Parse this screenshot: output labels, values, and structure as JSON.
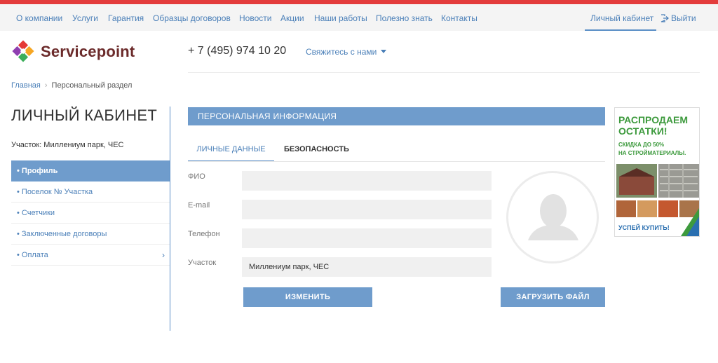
{
  "topnav": {
    "items": [
      "О компании",
      "Услуги",
      "Гарантия",
      "Образцы договоров",
      "Новости",
      "Акции",
      "Наши работы",
      "Полезно знать",
      "Контакты"
    ],
    "cabinet": "Личный кабинет",
    "logout": "Выйти"
  },
  "header": {
    "brand": "Servicepoint",
    "phone": "+ 7 (495) 974 10 20",
    "contact_link": "Свяжитесь с нами"
  },
  "breadcrumb": {
    "home": "Главная",
    "current": "Персональный раздел"
  },
  "sidebar": {
    "title": "ЛИЧНЫЙ КАБИНЕТ",
    "plot": "Участок: Миллениум парк, ЧЕС",
    "items": [
      {
        "label": "• Профиль"
      },
      {
        "label": "• Поселок № Участка"
      },
      {
        "label": "• Счетчики"
      },
      {
        "label": "• Заключенные договоры"
      },
      {
        "label": "• Оплата",
        "chevron": "›"
      }
    ]
  },
  "main": {
    "section_title": "ПЕРСОНАЛЬНАЯ ИНФОРМАЦИЯ",
    "tabs": [
      "ЛИЧНЫЕ ДАННЫЕ",
      "БЕЗОПАСНОСТЬ"
    ],
    "fields": [
      {
        "label": "ФИО",
        "value": ""
      },
      {
        "label": "E-mail",
        "value": ""
      },
      {
        "label": "Телефон",
        "value": ""
      },
      {
        "label": "Участок",
        "value": "Миллениум парк, ЧЕС"
      }
    ],
    "change_button": "ИЗМЕНИТЬ",
    "upload_button": "ЗАГРУЗИТЬ ФАЙЛ"
  },
  "banner": {
    "title_line1": "РАСПРОДАЕМ",
    "title_line2": "ОСТАТКИ!",
    "sub_line1": "СКИДКА ДО 50%",
    "sub_line2": "НА СТРОЙМАТЕРИАЛЫ.",
    "cta": "УСПЕЙ КУПИТЬ!"
  },
  "colors": {
    "accent": "#6f9ccc",
    "link": "#4a7fb8",
    "top_stripe": "#e33c3c",
    "brand": "#6b2a2a",
    "banner_green": "#3d9a3d"
  }
}
